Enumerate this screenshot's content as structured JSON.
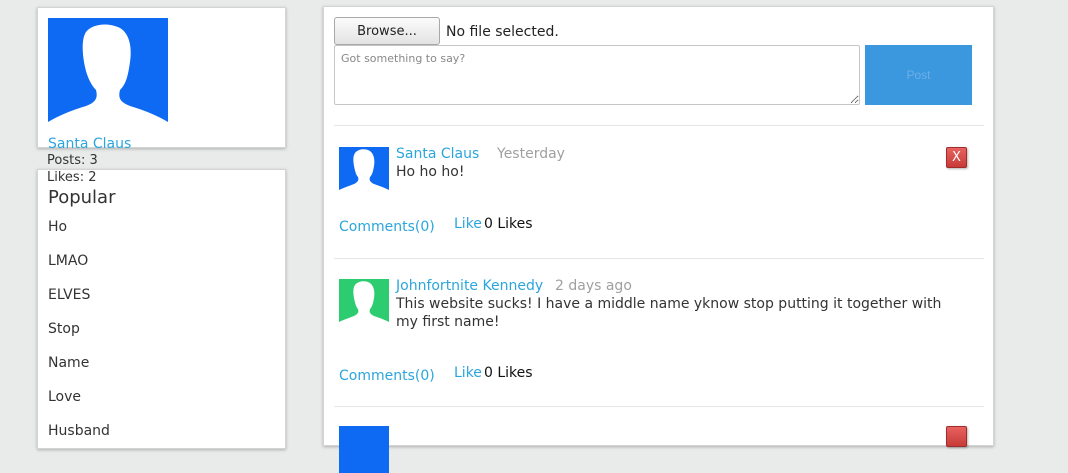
{
  "profile": {
    "name": "Santa Claus",
    "posts": "Posts: 3",
    "likes": "Likes: 2",
    "avatar_color": "#0e6af3"
  },
  "popular": {
    "title": "Popular",
    "items": [
      "Ho",
      "LMAO",
      "ELVES",
      "Stop",
      "Name",
      "Love",
      "Husband"
    ]
  },
  "composer": {
    "browse_label": "Browse...",
    "file_status": "No file selected.",
    "placeholder": "Got something to say?",
    "post_label": "Post"
  },
  "posts": [
    {
      "author": "Santa Claus",
      "time": "Yesterday",
      "text": "Ho ho ho!",
      "comments": "Comments(0)",
      "like": "Like",
      "likes": "0 Likes",
      "delete": "X",
      "avatar_color": "#0e6af3"
    },
    {
      "author": "Johnfortnite Kennedy",
      "time": "2 days ago",
      "text": "This website sucks! I have a middle name yknow stop putting it together with my first name!",
      "comments": "Comments(0)",
      "like": "Like",
      "likes": "0 Likes",
      "avatar_color": "#2ecc71"
    }
  ]
}
